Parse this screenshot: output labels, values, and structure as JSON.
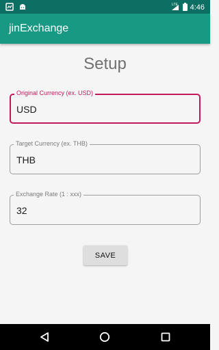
{
  "status_bar": {
    "time": "4:46",
    "network": "LTE",
    "icons": [
      "notification-icon",
      "android-icon",
      "lte-icon",
      "signal-icon",
      "battery-icon"
    ]
  },
  "app_bar": {
    "title": "jinExchange",
    "color": "#179984"
  },
  "setup": {
    "title": "Setup",
    "fields": [
      {
        "label": "Original Currency (ex. USD)",
        "value": "USD",
        "focused": true
      },
      {
        "label": "Target Currency (ex. THB)",
        "value": "THB",
        "focused": false
      },
      {
        "label": "Exchange Rate (1 : xxx)",
        "value": "32",
        "focused": false
      }
    ],
    "save_label": "SAVE"
  },
  "nav_bar": {
    "icons": [
      "back-icon",
      "home-icon",
      "recents-icon"
    ]
  },
  "colors": {
    "accent": "#c2185b",
    "primary": "#179984",
    "primary_dark": "#0d6f63"
  }
}
